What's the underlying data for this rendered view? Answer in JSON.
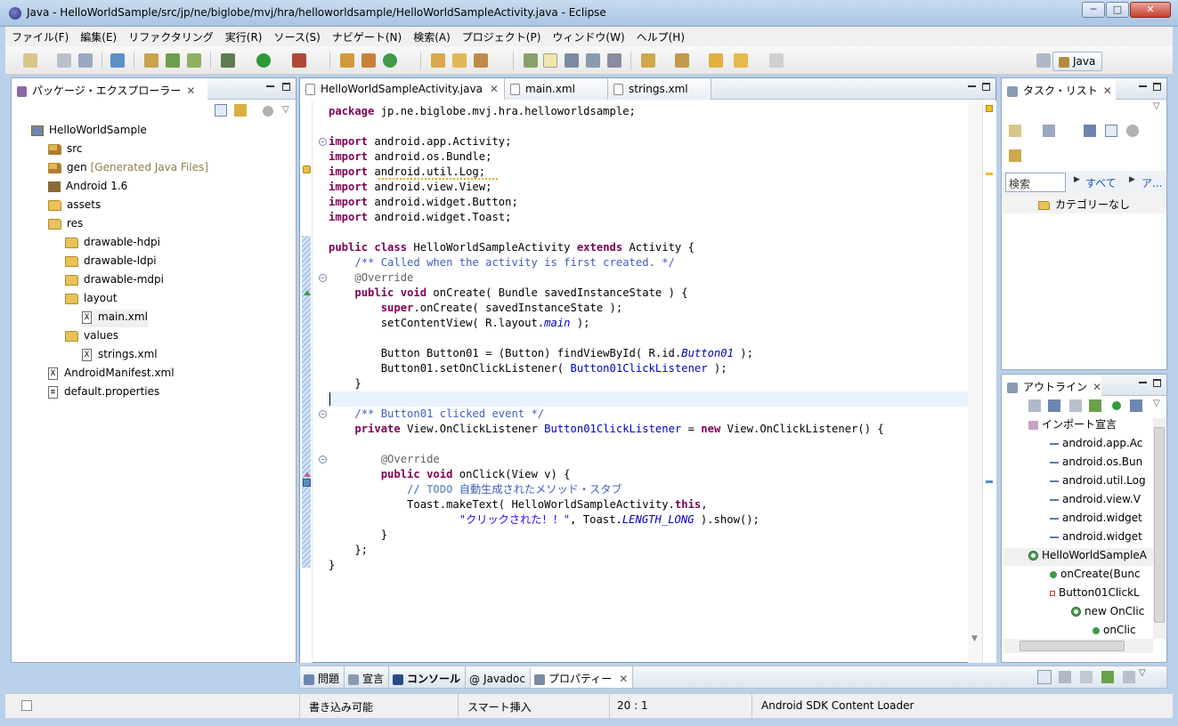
{
  "window": {
    "title": "Java - HelloWorldSample/src/jp/ne/biglobe/mvj/hra/helloworldsample/HelloWorldSampleActivity.java - Eclipse"
  },
  "menu": [
    "ファイル(F)",
    "編集(E)",
    "リファクタリング",
    "実行(R)",
    "ソース(S)",
    "ナビゲート(N)",
    "検索(A)",
    "プロジェクト(P)",
    "ウィンドウ(W)",
    "ヘルプ(H)"
  ],
  "perspective": {
    "label": "Java"
  },
  "package_explorer": {
    "title": "パッケージ・エクスプローラー",
    "tree": [
      {
        "label": "HelloWorldSample",
        "depth": 0,
        "icon": "project-icon"
      },
      {
        "label": "src",
        "depth": 1,
        "icon": "src-folder-icon"
      },
      {
        "label": "gen",
        "suffix": "[Generated Java Files]",
        "depth": 1,
        "icon": "src-folder-icon"
      },
      {
        "label": "Android 1.6",
        "depth": 1,
        "icon": "library-icon"
      },
      {
        "label": "assets",
        "depth": 1,
        "icon": "folder-icon"
      },
      {
        "label": "res",
        "depth": 1,
        "icon": "folder-icon"
      },
      {
        "label": "drawable-hdpi",
        "depth": 2,
        "icon": "folder-icon"
      },
      {
        "label": "drawable-ldpi",
        "depth": 2,
        "icon": "folder-icon"
      },
      {
        "label": "drawable-mdpi",
        "depth": 2,
        "icon": "folder-icon"
      },
      {
        "label": "layout",
        "depth": 2,
        "icon": "folder-icon"
      },
      {
        "label": "main.xml",
        "depth": 3,
        "icon": "xml-file-icon"
      },
      {
        "label": "values",
        "depth": 2,
        "icon": "folder-icon"
      },
      {
        "label": "strings.xml",
        "depth": 3,
        "icon": "xml-file-icon"
      },
      {
        "label": "AndroidManifest.xml",
        "depth": 1,
        "icon": "xml-file-icon"
      },
      {
        "label": "default.properties",
        "depth": 1,
        "icon": "properties-file-icon"
      }
    ]
  },
  "editor": {
    "tabs": [
      {
        "label": "HelloWorldSampleActivity.java",
        "active": true
      },
      {
        "label": "main.xml",
        "active": false
      },
      {
        "label": "strings.xml",
        "active": false
      }
    ],
    "lines": [
      "package jp.ne.biglobe.mvj.hra.helloworldsample;",
      "",
      "import android.app.Activity;",
      "import android.os.Bundle;",
      "import android.util.Log;",
      "import android.view.View;",
      "import android.widget.Button;",
      "import android.widget.Toast;",
      "",
      "public class HelloWorldSampleActivity extends Activity {",
      "    /** Called when the activity is first created. */",
      "    @Override",
      "    public void onCreate( Bundle savedInstanceState ) {",
      "        super.onCreate( savedInstanceState );",
      "        setContentView( R.layout.main );",
      "",
      "        Button Button01 = (Button) findViewById( R.id.Button01 );",
      "        Button01.setOnClickListener( Button01ClickListener );",
      "    }",
      "",
      "    /** Button01 clicked event */",
      "    private View.OnClickListener Button01ClickListener = new View.OnClickListener() {",
      "",
      "        @Override",
      "        public void onClick(View v) {",
      "            // TODO 自動生成されたメソッド・スタブ",
      "            Toast.makeText( HelloWorldSampleActivity.this,",
      "                    \"クリックされた！！\", Toast.LENGTH_LONG ).show();",
      "        }",
      "    };",
      "}"
    ]
  },
  "task_list": {
    "title": "タスク・リスト",
    "search_value": "検索",
    "filter_all": "すべて",
    "filter_more": "ア...",
    "category": "カテゴリーなし"
  },
  "outline": {
    "title": "アウトライン",
    "items": [
      {
        "label": "インポート宣言",
        "depth": 0
      },
      {
        "label": "android.app.Ac",
        "depth": 1
      },
      {
        "label": "android.os.Bun",
        "depth": 1
      },
      {
        "label": "android.util.Log",
        "depth": 1
      },
      {
        "label": "android.view.V",
        "depth": 1
      },
      {
        "label": "android.widget",
        "depth": 1
      },
      {
        "label": "android.widget",
        "depth": 1
      },
      {
        "label": "HelloWorldSampleA",
        "depth": 0
      },
      {
        "label": "onCreate(Bunc",
        "depth": 1
      },
      {
        "label": "Button01ClickL",
        "depth": 1
      },
      {
        "label": "new OnClic",
        "depth": 2
      },
      {
        "label": "onClic",
        "depth": 3
      }
    ]
  },
  "bottom_tabs": [
    "問題",
    "宣言",
    "コンソール",
    "Javadoc",
    "プロパティー"
  ],
  "status": {
    "writable": "書き込み可能",
    "insert_mode": "スマート挿入",
    "position": "20 : 1",
    "task": "Android SDK Content Loader"
  },
  "colors": {
    "keyword": "#7f0055",
    "comment": "#3f5fbf",
    "field": "#0000c0",
    "string": "#2a00ff",
    "current_line": "#e8f2fe"
  }
}
